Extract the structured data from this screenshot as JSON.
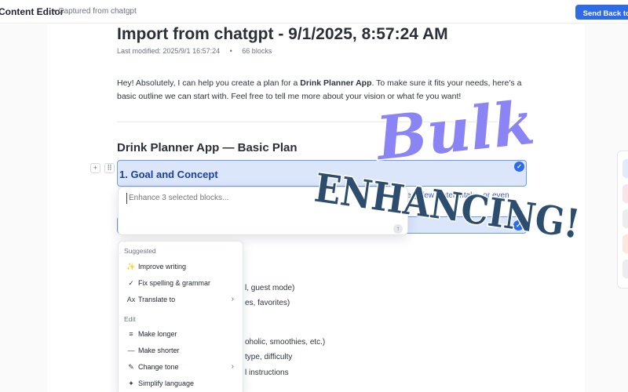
{
  "topbar": {
    "app_title": "Content Editor",
    "captured": "• Captured from chatgpt",
    "send_button": "Send Back to C"
  },
  "document": {
    "title": "Import from chatgpt - 9/1/2025, 8:57:24 AM",
    "last_modified": "Last modified: 2025/9/1 16:57:24",
    "meta_dot": "•",
    "block_count": "66 blocks",
    "intro_part1": "Hey! Absolutely, I can help you create a plan for a ",
    "intro_bold": "Drink Planner App",
    "intro_part2": ". To make sure it fits your needs, here's a basic outline we can start with. Feel free to tell me more about your vision or what fe",
    "intro_part3": "you want!",
    "section_heading": "Drink Planner App — Basic Plan",
    "selected_heading": "1. Goal and Concept",
    "ghost_text": "e.g. few water intake, or even",
    "bg_lines": [
      "l, guest mode)",
      "es, favorites)",
      "oholic, smoothies, etc.)",
      "type, difficulty",
      "l instructions"
    ]
  },
  "block_controls": {
    "add": "+",
    "drag": "⠿"
  },
  "enhance": {
    "placeholder": "Enhance 3 selected blocks...",
    "submit_icon": "↑",
    "check_icon": "✓"
  },
  "menu": {
    "section_suggested": "Suggested",
    "section_edit": "Edit",
    "items": [
      {
        "icon": "✨",
        "label": "Improve writing"
      },
      {
        "icon": "✓",
        "label": "Fix spelling & grammar"
      },
      {
        "icon": "Ax",
        "label": "Translate to",
        "chevron": "›"
      },
      {
        "icon": "≡",
        "label": "Make longer"
      },
      {
        "icon": "—",
        "label": "Make shorter"
      },
      {
        "icon": "✎",
        "label": "Change tone",
        "chevron": "›"
      },
      {
        "icon": "✦",
        "label": "Simplify language"
      }
    ]
  },
  "overlay": {
    "line1": "Bulk",
    "line2": "ENHANCING!"
  },
  "colors": {
    "accent_blue": "#2f6be4",
    "selection_bg": "#dbe6fb",
    "overlay_purple": "#8a84f4",
    "overlay_navy": "#2d4d6e"
  },
  "side_panel": {
    "chip_colors": [
      "#e3ebfb",
      "#fbe3ea",
      "#ececef",
      "#fde6de",
      "#ececef"
    ]
  }
}
